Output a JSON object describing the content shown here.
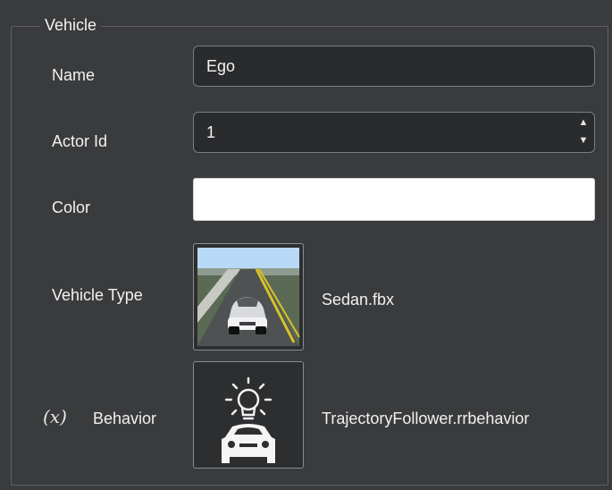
{
  "group": {
    "title": "Vehicle"
  },
  "name": {
    "label": "Name",
    "value": "Ego"
  },
  "actor_id": {
    "label": "Actor Id",
    "value": "1",
    "up_icon": "arrow-up-icon",
    "down_icon": "arrow-down-icon"
  },
  "color": {
    "label": "Color",
    "value": "#ffffff"
  },
  "vehicle_type": {
    "label": "Vehicle Type",
    "file": "Sedan.fbx",
    "thumbnail": "sedan-preview-image"
  },
  "behavior": {
    "variable_icon": "(x)",
    "label": "Behavior",
    "file": "TrajectoryFollower.rrbehavior",
    "icon": "behavior-lightbulb-car-icon"
  },
  "colors": {
    "background": "#3a3b3d",
    "field_background": "#2a2b2d",
    "field_border": "#7b7d80",
    "text": "#f1f1f1",
    "road_line": "#d8c12a"
  }
}
